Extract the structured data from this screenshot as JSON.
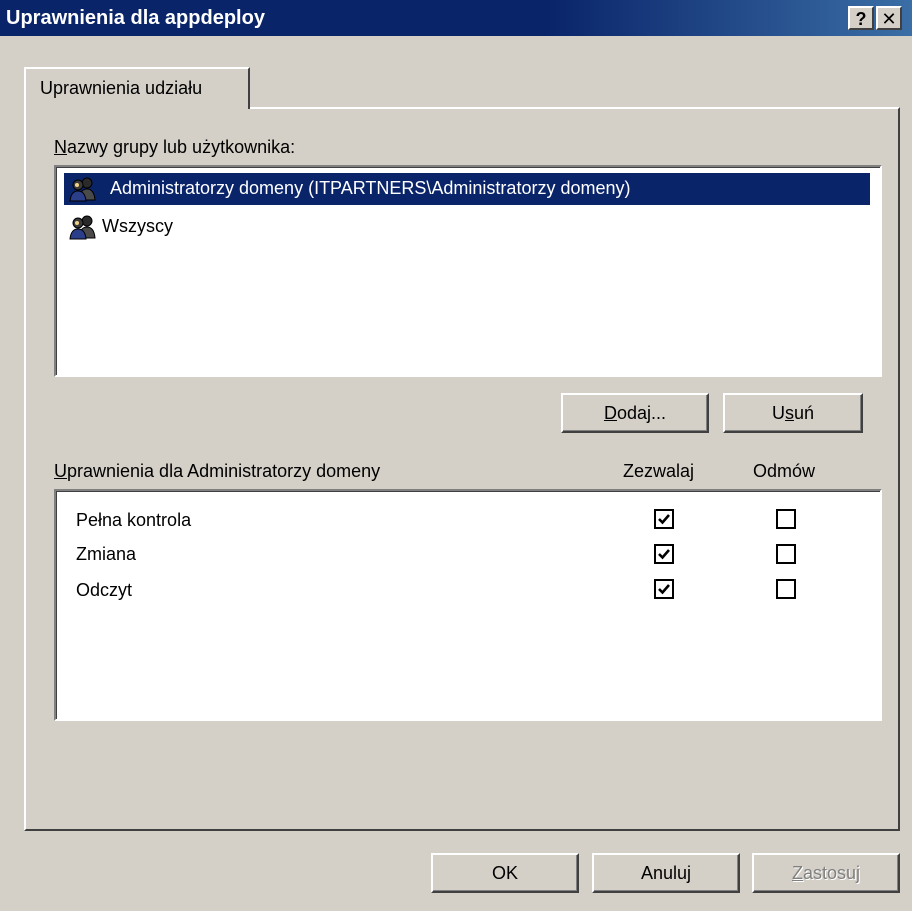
{
  "window": {
    "title": "Uprawnienia dla appdeploy",
    "help_label": "?",
    "close_label": "✕"
  },
  "tabs": [
    {
      "label": "Uprawnienia udziału"
    }
  ],
  "users_section": {
    "label_first": "N",
    "label_rest": "azwy grupy lub użytkownika:",
    "items": [
      {
        "name": "Administratorzy domeny (ITPARTNERS\\Administratorzy domeny)",
        "icon": "users-group-icon",
        "selected": true
      },
      {
        "name": "Wszyscy",
        "icon": "users-group-icon",
        "selected": false
      }
    ]
  },
  "buttons": {
    "add_first": "D",
    "add_rest": "odaj...",
    "remove_before": "U",
    "remove_ul": "s",
    "remove_after": "uń",
    "ok": "OK",
    "cancel": "Anuluj",
    "apply_first": "Z",
    "apply_rest": "astosuj"
  },
  "permissions_section": {
    "label_first": "U",
    "label_rest": "prawnienia dla Administratorzy domeny",
    "col_allow": "Zezwalaj",
    "col_deny": "Odmów",
    "rows": [
      {
        "name": "Pełna kontrola",
        "allow": true,
        "deny": false
      },
      {
        "name": "Zmiana",
        "allow": true,
        "deny": false
      },
      {
        "name": "Odczyt",
        "allow": true,
        "deny": false
      }
    ]
  },
  "colors": {
    "titlebar": "#0a246a",
    "selection": "#0a246a",
    "face": "#d4d0c8"
  }
}
